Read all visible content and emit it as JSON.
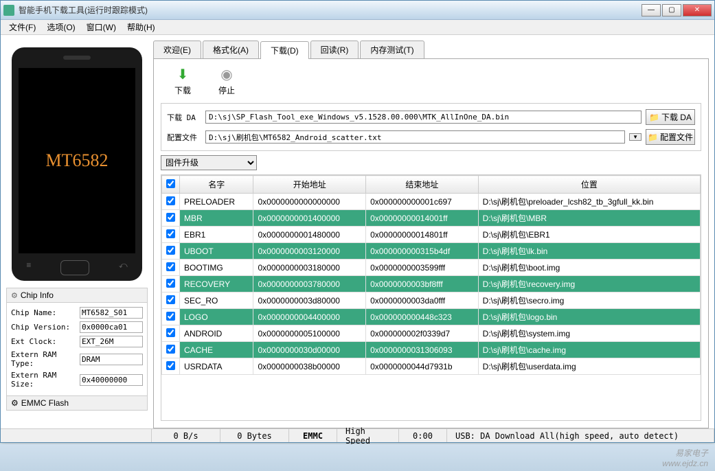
{
  "window": {
    "title": "智能手机下载工具(运行时跟踪模式)"
  },
  "menubar": {
    "file": "文件(F)",
    "options": "选项(O)",
    "window": "窗口(W)",
    "help": "帮助(H)"
  },
  "phone": {
    "model": "MT6582"
  },
  "chipinfo": {
    "header": "Chip Info",
    "rows": [
      {
        "label": "Chip Name:",
        "value": "MT6582_S01"
      },
      {
        "label": "Chip Version:",
        "value": "0x0000ca01"
      },
      {
        "label": "Ext Clock:",
        "value": "EXT_26M"
      },
      {
        "label": "Extern RAM Type:",
        "value": "DRAM"
      },
      {
        "label": "Extern RAM Size:",
        "value": "0x40000000"
      }
    ],
    "emmc_header": "EMMC Flash"
  },
  "tabs": {
    "welcome": "欢迎(E)",
    "format": "格式化(A)",
    "download": "下载(D)",
    "readback": "回读(R)",
    "memtest": "内存测试(T)"
  },
  "toolbar": {
    "download": "下载",
    "stop": "停止"
  },
  "fields": {
    "da_label": "下载 DA",
    "da_value": "D:\\sj\\SP_Flash_Tool_exe_Windows_v5.1528.00.000\\MTK_AllInOne_DA.bin",
    "da_button": "下载 DA",
    "scatter_label": "配置文件",
    "scatter_value": "D:\\sj\\刷机包\\MT6582_Android_scatter.txt",
    "scatter_button": "配置文件",
    "mode": "固件升级"
  },
  "grid": {
    "headers": {
      "name": "名字",
      "start": "开始地址",
      "end": "结束地址",
      "location": "位置"
    },
    "rows": [
      {
        "chk": true,
        "green": false,
        "name": "PRELOADER",
        "start": "0x0000000000000000",
        "end": "0x000000000001c697",
        "loc": "D:\\sj\\刷机包\\preloader_lcsh82_tb_3gfull_kk.bin"
      },
      {
        "chk": true,
        "green": true,
        "name": "MBR",
        "start": "0x0000000001400000",
        "end": "0x00000000014001ff",
        "loc": "D:\\sj\\刷机包\\MBR"
      },
      {
        "chk": true,
        "green": false,
        "name": "EBR1",
        "start": "0x0000000001480000",
        "end": "0x00000000014801ff",
        "loc": "D:\\sj\\刷机包\\EBR1"
      },
      {
        "chk": true,
        "green": true,
        "name": "UBOOT",
        "start": "0x0000000003120000",
        "end": "0x000000000315b4df",
        "loc": "D:\\sj\\刷机包\\lk.bin"
      },
      {
        "chk": true,
        "green": false,
        "name": "BOOTIMG",
        "start": "0x0000000003180000",
        "end": "0x0000000003599fff",
        "loc": "D:\\sj\\刷机包\\boot.img"
      },
      {
        "chk": true,
        "green": true,
        "name": "RECOVERY",
        "start": "0x0000000003780000",
        "end": "0x0000000003bf8fff",
        "loc": "D:\\sj\\刷机包\\recovery.img"
      },
      {
        "chk": true,
        "green": false,
        "name": "SEC_RO",
        "start": "0x0000000003d80000",
        "end": "0x0000000003da0fff",
        "loc": "D:\\sj\\刷机包\\secro.img"
      },
      {
        "chk": true,
        "green": true,
        "name": "LOGO",
        "start": "0x0000000004400000",
        "end": "0x000000000448c323",
        "loc": "D:\\sj\\刷机包\\logo.bin"
      },
      {
        "chk": true,
        "green": false,
        "name": "ANDROID",
        "start": "0x0000000005100000",
        "end": "0x000000002f0339d7",
        "loc": "D:\\sj\\刷机包\\system.img"
      },
      {
        "chk": true,
        "green": true,
        "name": "CACHE",
        "start": "0x0000000030d00000",
        "end": "0x0000000031306093",
        "loc": "D:\\sj\\刷机包\\cache.img"
      },
      {
        "chk": true,
        "green": false,
        "name": "USRDATA",
        "start": "0x0000000038b00000",
        "end": "0x0000000044d7931b",
        "loc": "D:\\sj\\刷机包\\userdata.img"
      }
    ]
  },
  "statusbar": {
    "speed": "0 B/s",
    "bytes": "0 Bytes",
    "storage": "EMMC",
    "mode": "High Speed",
    "time": "0:00",
    "usb": "USB: DA Download All(high speed, auto detect)"
  },
  "watermark": {
    "line1": "易家电子",
    "line2": "www.ejdz.cn"
  }
}
